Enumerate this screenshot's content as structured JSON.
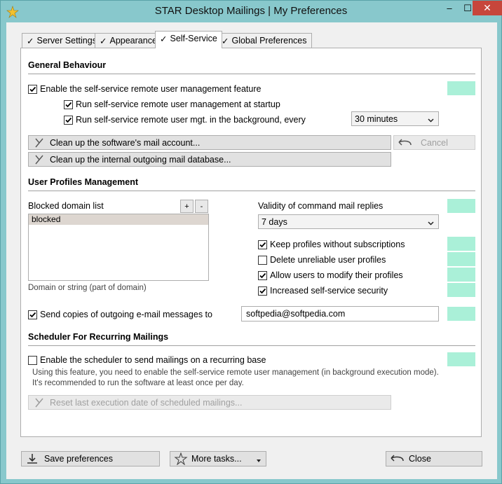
{
  "window": {
    "title": "STAR Desktop Mailings | My Preferences",
    "minimize": "–",
    "maximize": "☐",
    "close": "✕"
  },
  "tabs": [
    {
      "label": "Server Settings",
      "checked": true,
      "active": false
    },
    {
      "label": "Appearance",
      "checked": true,
      "active": false
    },
    {
      "label": "Self-Service",
      "checked": true,
      "active": true
    },
    {
      "label": "Global Preferences",
      "checked": true,
      "active": false
    }
  ],
  "general": {
    "title": "General Behaviour",
    "enable_label": "Enable the self-service remote user management feature",
    "enable_checked": true,
    "run_startup_label": "Run self-service remote user management at startup",
    "run_startup_checked": true,
    "run_background_label": "Run self-service remote user mgt. in the background, every",
    "run_background_checked": true,
    "interval_value": "30 minutes",
    "cleanup_mail_label": "Clean up the software's mail account...",
    "cancel_label": "Cancel",
    "cleanup_db_label": "Clean up the internal outgoing mail database..."
  },
  "profiles": {
    "title": "User Profiles Management",
    "blocked_label": "Blocked domain list",
    "add_label": "+",
    "remove_label": "-",
    "blocked_items": [
      "blocked"
    ],
    "blocked_hint": "Domain or string (part of domain)",
    "validity_label": "Validity of command mail replies",
    "validity_value": "7 days",
    "keep_label": "Keep profiles without subscriptions",
    "keep_checked": true,
    "delete_label": "Delete unreliable user profiles",
    "delete_checked": false,
    "allow_label": "Allow users to modify their profiles",
    "allow_checked": true,
    "increased_label": "Increased self-service security",
    "increased_checked": true,
    "send_copies_label": "Send copies of outgoing e-mail messages to",
    "send_copies_checked": true,
    "send_copies_email": "softpedia@softpedia.com"
  },
  "scheduler": {
    "title": "Scheduler For Recurring Mailings",
    "enable_label": "Enable the scheduler to send mailings on a recurring base",
    "enable_checked": false,
    "note_line1": "Using this feature, you need to enable the self-service remote user management (in background execution mode).",
    "note_line2": "It's recommended to run the software at least once per day.",
    "reset_label": "Reset last execution date of scheduled mailings..."
  },
  "footer": {
    "save_label": "Save preferences",
    "more_label": "More tasks...",
    "close_label": "Close"
  },
  "colors": {
    "swatch": "#aaf0d8",
    "titlebar": "#88c8cc",
    "close_button": "#c7463b"
  }
}
